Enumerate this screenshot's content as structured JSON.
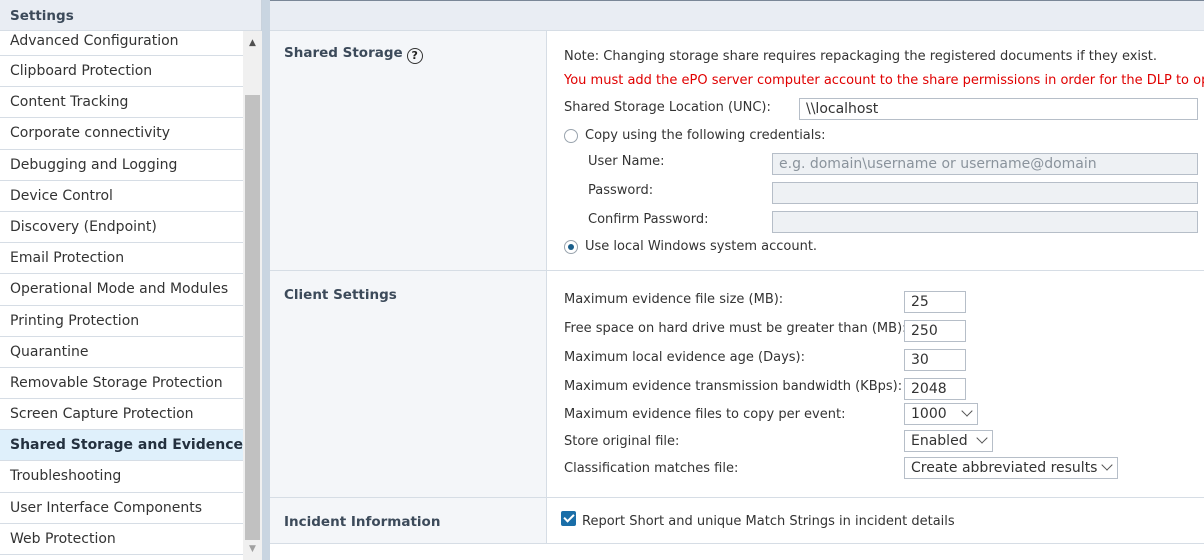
{
  "sidebar": {
    "title": "Settings",
    "items": [
      {
        "label": "Advanced Configuration"
      },
      {
        "label": "Clipboard Protection"
      },
      {
        "label": "Content Tracking"
      },
      {
        "label": "Corporate connectivity"
      },
      {
        "label": "Debugging and Logging"
      },
      {
        "label": "Device Control"
      },
      {
        "label": "Discovery (Endpoint)"
      },
      {
        "label": "Email Protection"
      },
      {
        "label": "Operational Mode and Modules"
      },
      {
        "label": "Printing Protection"
      },
      {
        "label": "Quarantine"
      },
      {
        "label": "Removable Storage Protection"
      },
      {
        "label": "Screen Capture Protection"
      },
      {
        "label": "Shared Storage and Evidence"
      },
      {
        "label": "Troubleshooting"
      },
      {
        "label": "User Interface Components"
      },
      {
        "label": "Web Protection"
      }
    ],
    "active_index": 13
  },
  "shared_storage": {
    "label": "Shared Storage",
    "help_icon": "?",
    "note": "Note: Changing storage share requires repackaging the registered documents if they exist.",
    "warning": "You must add the ePO server computer account to the share permissions in order for the DLP to open",
    "location_label": "Shared Storage Location (UNC):",
    "location_value": "\\\\localhost",
    "copy_credentials_label": "Copy using the following credentials:",
    "username_label": "User Name:",
    "username_placeholder": "e.g. domain\\username or username@domain",
    "password_label": "Password:",
    "confirm_password_label": "Confirm Password:",
    "local_account_label": "Use local Windows system account."
  },
  "client_settings": {
    "label": "Client Settings",
    "max_file_size_label": "Maximum evidence file size (MB):",
    "max_file_size_value": "25",
    "free_space_label": "Free space on hard drive must be greater than (MB):",
    "free_space_value": "250",
    "max_age_label": "Maximum local evidence age (Days):",
    "max_age_value": "30",
    "bandwidth_label": "Maximum evidence transmission bandwidth (KBps):",
    "bandwidth_value": "2048",
    "files_per_event_label": "Maximum evidence files to copy per event:",
    "files_per_event_value": "1000",
    "store_original_label": "Store original file:",
    "store_original_value": "Enabled",
    "classification_label": "Classification matches file:",
    "classification_value": "Create abbreviated results"
  },
  "incident": {
    "label": "Incident Information",
    "report_label": "Report Short and unique Match Strings in incident details"
  }
}
